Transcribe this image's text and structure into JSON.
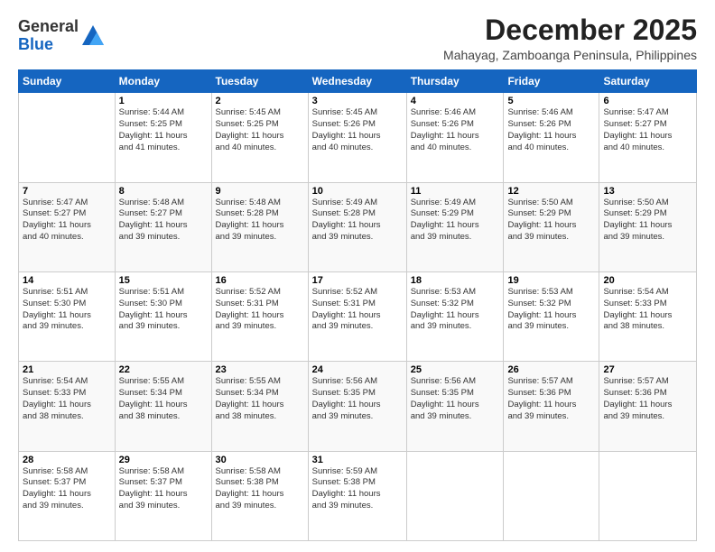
{
  "logo": {
    "general": "General",
    "blue": "Blue"
  },
  "title": "December 2025",
  "subtitle": "Mahayag, Zamboanga Peninsula, Philippines",
  "days_header": [
    "Sunday",
    "Monday",
    "Tuesday",
    "Wednesday",
    "Thursday",
    "Friday",
    "Saturday"
  ],
  "weeks": [
    [
      {
        "day": "",
        "info": ""
      },
      {
        "day": "1",
        "info": "Sunrise: 5:44 AM\nSunset: 5:25 PM\nDaylight: 11 hours\nand 41 minutes."
      },
      {
        "day": "2",
        "info": "Sunrise: 5:45 AM\nSunset: 5:25 PM\nDaylight: 11 hours\nand 40 minutes."
      },
      {
        "day": "3",
        "info": "Sunrise: 5:45 AM\nSunset: 5:26 PM\nDaylight: 11 hours\nand 40 minutes."
      },
      {
        "day": "4",
        "info": "Sunrise: 5:46 AM\nSunset: 5:26 PM\nDaylight: 11 hours\nand 40 minutes."
      },
      {
        "day": "5",
        "info": "Sunrise: 5:46 AM\nSunset: 5:26 PM\nDaylight: 11 hours\nand 40 minutes."
      },
      {
        "day": "6",
        "info": "Sunrise: 5:47 AM\nSunset: 5:27 PM\nDaylight: 11 hours\nand 40 minutes."
      }
    ],
    [
      {
        "day": "7",
        "info": "Sunrise: 5:47 AM\nSunset: 5:27 PM\nDaylight: 11 hours\nand 40 minutes."
      },
      {
        "day": "8",
        "info": "Sunrise: 5:48 AM\nSunset: 5:27 PM\nDaylight: 11 hours\nand 39 minutes."
      },
      {
        "day": "9",
        "info": "Sunrise: 5:48 AM\nSunset: 5:28 PM\nDaylight: 11 hours\nand 39 minutes."
      },
      {
        "day": "10",
        "info": "Sunrise: 5:49 AM\nSunset: 5:28 PM\nDaylight: 11 hours\nand 39 minutes."
      },
      {
        "day": "11",
        "info": "Sunrise: 5:49 AM\nSunset: 5:29 PM\nDaylight: 11 hours\nand 39 minutes."
      },
      {
        "day": "12",
        "info": "Sunrise: 5:50 AM\nSunset: 5:29 PM\nDaylight: 11 hours\nand 39 minutes."
      },
      {
        "day": "13",
        "info": "Sunrise: 5:50 AM\nSunset: 5:29 PM\nDaylight: 11 hours\nand 39 minutes."
      }
    ],
    [
      {
        "day": "14",
        "info": "Sunrise: 5:51 AM\nSunset: 5:30 PM\nDaylight: 11 hours\nand 39 minutes."
      },
      {
        "day": "15",
        "info": "Sunrise: 5:51 AM\nSunset: 5:30 PM\nDaylight: 11 hours\nand 39 minutes."
      },
      {
        "day": "16",
        "info": "Sunrise: 5:52 AM\nSunset: 5:31 PM\nDaylight: 11 hours\nand 39 minutes."
      },
      {
        "day": "17",
        "info": "Sunrise: 5:52 AM\nSunset: 5:31 PM\nDaylight: 11 hours\nand 39 minutes."
      },
      {
        "day": "18",
        "info": "Sunrise: 5:53 AM\nSunset: 5:32 PM\nDaylight: 11 hours\nand 39 minutes."
      },
      {
        "day": "19",
        "info": "Sunrise: 5:53 AM\nSunset: 5:32 PM\nDaylight: 11 hours\nand 39 minutes."
      },
      {
        "day": "20",
        "info": "Sunrise: 5:54 AM\nSunset: 5:33 PM\nDaylight: 11 hours\nand 38 minutes."
      }
    ],
    [
      {
        "day": "21",
        "info": "Sunrise: 5:54 AM\nSunset: 5:33 PM\nDaylight: 11 hours\nand 38 minutes."
      },
      {
        "day": "22",
        "info": "Sunrise: 5:55 AM\nSunset: 5:34 PM\nDaylight: 11 hours\nand 38 minutes."
      },
      {
        "day": "23",
        "info": "Sunrise: 5:55 AM\nSunset: 5:34 PM\nDaylight: 11 hours\nand 38 minutes."
      },
      {
        "day": "24",
        "info": "Sunrise: 5:56 AM\nSunset: 5:35 PM\nDaylight: 11 hours\nand 39 minutes."
      },
      {
        "day": "25",
        "info": "Sunrise: 5:56 AM\nSunset: 5:35 PM\nDaylight: 11 hours\nand 39 minutes."
      },
      {
        "day": "26",
        "info": "Sunrise: 5:57 AM\nSunset: 5:36 PM\nDaylight: 11 hours\nand 39 minutes."
      },
      {
        "day": "27",
        "info": "Sunrise: 5:57 AM\nSunset: 5:36 PM\nDaylight: 11 hours\nand 39 minutes."
      }
    ],
    [
      {
        "day": "28",
        "info": "Sunrise: 5:58 AM\nSunset: 5:37 PM\nDaylight: 11 hours\nand 39 minutes."
      },
      {
        "day": "29",
        "info": "Sunrise: 5:58 AM\nSunset: 5:37 PM\nDaylight: 11 hours\nand 39 minutes."
      },
      {
        "day": "30",
        "info": "Sunrise: 5:58 AM\nSunset: 5:38 PM\nDaylight: 11 hours\nand 39 minutes."
      },
      {
        "day": "31",
        "info": "Sunrise: 5:59 AM\nSunset: 5:38 PM\nDaylight: 11 hours\nand 39 minutes."
      },
      {
        "day": "",
        "info": ""
      },
      {
        "day": "",
        "info": ""
      },
      {
        "day": "",
        "info": ""
      }
    ]
  ]
}
